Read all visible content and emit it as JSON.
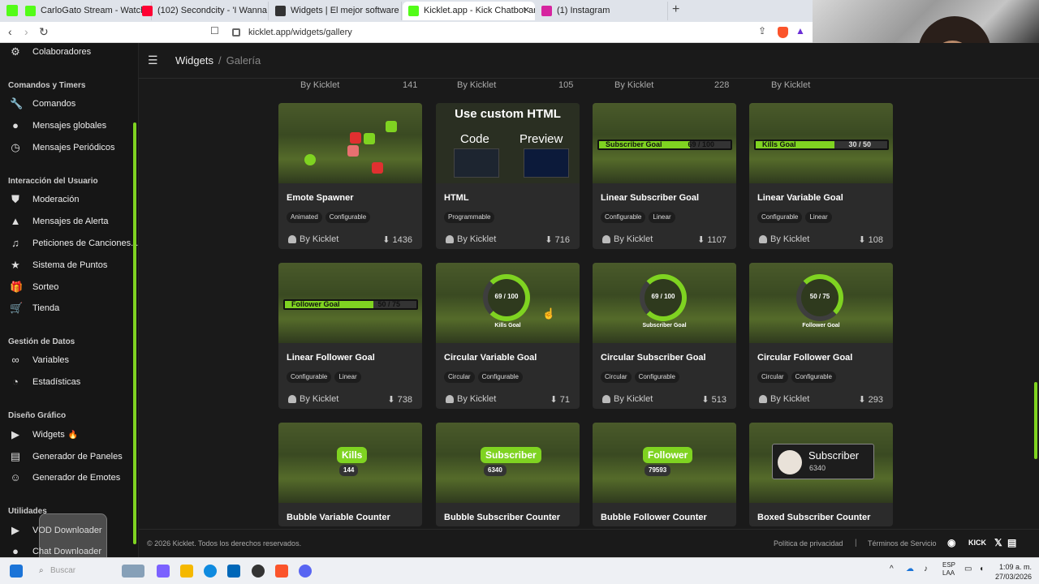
{
  "browser": {
    "tabs": [
      {
        "label": "CarloGato Stream - Watch Live o",
        "color": "#53fc18"
      },
      {
        "label": "(102) Secondcity - 'I Wanna Feel' (Of",
        "color": "#ff0033"
      },
      {
        "label": "Widgets | El mejor software para pot",
        "color": "#333333"
      },
      {
        "label": "Kicklet.app - Kick Chatbot and O",
        "color": "#53fc18"
      },
      {
        "label": "(1) Instagram",
        "color": "#d6249f"
      }
    ],
    "url": "kicklet.app/widgets/gallery"
  },
  "sidebar": {
    "top_item": "Colaboradores",
    "sections": [
      {
        "title": "Comandos y Timers",
        "items": [
          "Comandos",
          "Mensajes globales",
          "Mensajes Periódicos"
        ]
      },
      {
        "title": "Interacción del Usuario",
        "items": [
          "Moderación",
          "Mensajes de Alerta",
          "Peticiones de Canciones...",
          "Sistema de Puntos",
          "Sorteo",
          "Tienda"
        ]
      },
      {
        "title": "Gestión de Datos",
        "items": [
          "Variables",
          "Estadísticas"
        ]
      },
      {
        "title": "Diseño Gráfico",
        "items": [
          "Widgets",
          "Generador de Paneles",
          "Generador de Emotes"
        ]
      },
      {
        "title": "Utilidades",
        "items": [
          "VOD Downloader",
          "Chat Downloader"
        ]
      }
    ]
  },
  "header": {
    "crumb1": "Widgets",
    "crumb2": "Galería"
  },
  "prev_row": {
    "by": "By Kicklet",
    "counts": [
      "141",
      "105",
      "228",
      ""
    ]
  },
  "cards": [
    {
      "title": "Emote Spawner",
      "tags": [
        "Animated",
        "Configurable"
      ],
      "by": "By Kicklet",
      "downloads": "1436",
      "kind": "emote"
    },
    {
      "title": "HTML",
      "tags": [
        "Programmable"
      ],
      "by": "By Kicklet",
      "downloads": "716",
      "kind": "html",
      "thumb_title": "Use custom HTML",
      "thumb_code": "Code",
      "thumb_preview": "Preview"
    },
    {
      "title": "Linear Subscriber Goal",
      "tags": [
        "Configurable",
        "Linear"
      ],
      "by": "By Kicklet",
      "downloads": "1107",
      "kind": "bar",
      "bar_label": "Subscriber Goal",
      "bar_value": "69 / 100",
      "fill": 0.69
    },
    {
      "title": "Linear Variable Goal",
      "tags": [
        "Configurable",
        "Linear"
      ],
      "by": "By Kicklet",
      "downloads": "108",
      "kind": "bar",
      "bar_label": "Kills Goal",
      "bar_value": "30 / 50",
      "fill": 0.6
    },
    {
      "title": "Linear Follower Goal",
      "tags": [
        "Configurable",
        "Linear"
      ],
      "by": "By Kicklet",
      "downloads": "738",
      "kind": "bar",
      "bar_label": "Follower Goal",
      "bar_value": "50 / 75",
      "fill": 0.67
    },
    {
      "title": "Circular Variable Goal",
      "tags": [
        "Circular",
        "Configurable"
      ],
      "by": "By Kicklet",
      "downloads": "71",
      "kind": "ring",
      "ring_value": "69 / 100",
      "ring_label": "Kills Goal"
    },
    {
      "title": "Circular Subscriber Goal",
      "tags": [
        "Circular",
        "Configurable"
      ],
      "by": "By Kicklet",
      "downloads": "513",
      "kind": "ring",
      "ring_value": "69 / 100",
      "ring_label": "Subscriber Goal"
    },
    {
      "title": "Circular Follower Goal",
      "tags": [
        "Circular",
        "Configurable"
      ],
      "by": "By Kicklet",
      "downloads": "293",
      "kind": "ring",
      "ring_value": "50 / 75",
      "ring_label": "Follower Goal"
    },
    {
      "title": "Bubble Variable Counter",
      "kind": "bubble",
      "bubble_label": "Kills",
      "bubble_value": "144"
    },
    {
      "title": "Bubble Subscriber Counter",
      "kind": "bubble",
      "bubble_label": "Subscriber",
      "bubble_value": "6340"
    },
    {
      "title": "Bubble Follower Counter",
      "kind": "bubble",
      "bubble_label": "Follower",
      "bubble_value": "79593"
    },
    {
      "title": "Boxed Subscriber Counter",
      "kind": "boxed",
      "boxed_label": "Subscriber",
      "boxed_value": "6340"
    }
  ],
  "footer": {
    "copyright": "© 2026 Kicklet. Todos los derechos reservados.",
    "privacy": "Política de privacidad",
    "separator": "|",
    "terms": "Términos de Servicio"
  },
  "taskbar": {
    "search": "Buscar",
    "lang1": "ESP",
    "lang2": "LAA",
    "time": "1:09 a. m.",
    "date": "27/03/2026"
  },
  "accent": "#7fd321"
}
